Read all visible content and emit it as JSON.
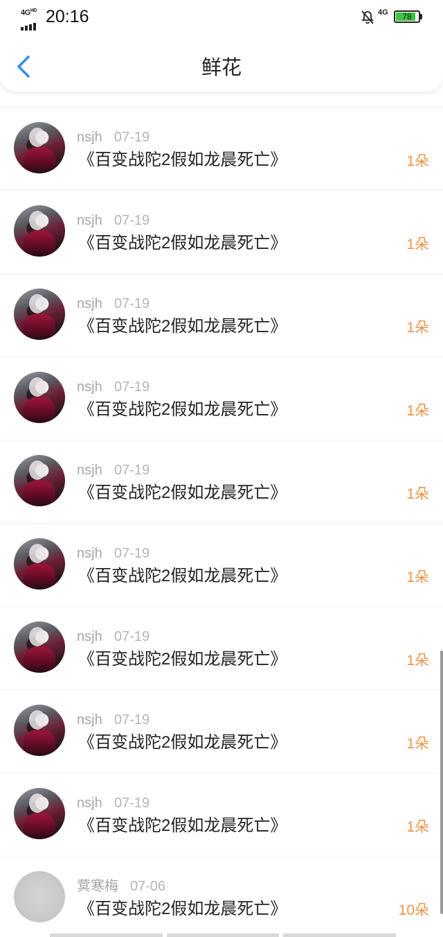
{
  "status_bar": {
    "signal_label": "4G",
    "signal_hd": "HD",
    "time": "20:16",
    "network": "4G",
    "battery": "78"
  },
  "header": {
    "title": "鲜花"
  },
  "colors": {
    "accent_blue": "#2f8fe3",
    "flower_orange": "#f09346",
    "battery_green": "#3fc445"
  },
  "list": [
    {
      "username": "nsjh",
      "date": "07-19",
      "title": "《百变战陀2假如龙晨死亡》",
      "count": "1朵"
    },
    {
      "username": "nsjh",
      "date": "07-19",
      "title": "《百变战陀2假如龙晨死亡》",
      "count": "1朵"
    },
    {
      "username": "nsjh",
      "date": "07-19",
      "title": "《百变战陀2假如龙晨死亡》",
      "count": "1朵"
    },
    {
      "username": "nsjh",
      "date": "07-19",
      "title": "《百变战陀2假如龙晨死亡》",
      "count": "1朵"
    },
    {
      "username": "nsjh",
      "date": "07-19",
      "title": "《百变战陀2假如龙晨死亡》",
      "count": "1朵"
    },
    {
      "username": "nsjh",
      "date": "07-19",
      "title": "《百变战陀2假如龙晨死亡》",
      "count": "1朵"
    },
    {
      "username": "nsjh",
      "date": "07-19",
      "title": "《百变战陀2假如龙晨死亡》",
      "count": "1朵"
    },
    {
      "username": "nsjh",
      "date": "07-19",
      "title": "《百变战陀2假如龙晨死亡》",
      "count": "1朵"
    },
    {
      "username": "nsjh",
      "date": "07-19",
      "title": "《百变战陀2假如龙晨死亡》",
      "count": "1朵"
    },
    {
      "username": "蓂寒梅",
      "date": "07-06",
      "title": "《百变战陀2假如龙晨死亡》",
      "count": "10朵",
      "avatar_style": "light"
    }
  ]
}
